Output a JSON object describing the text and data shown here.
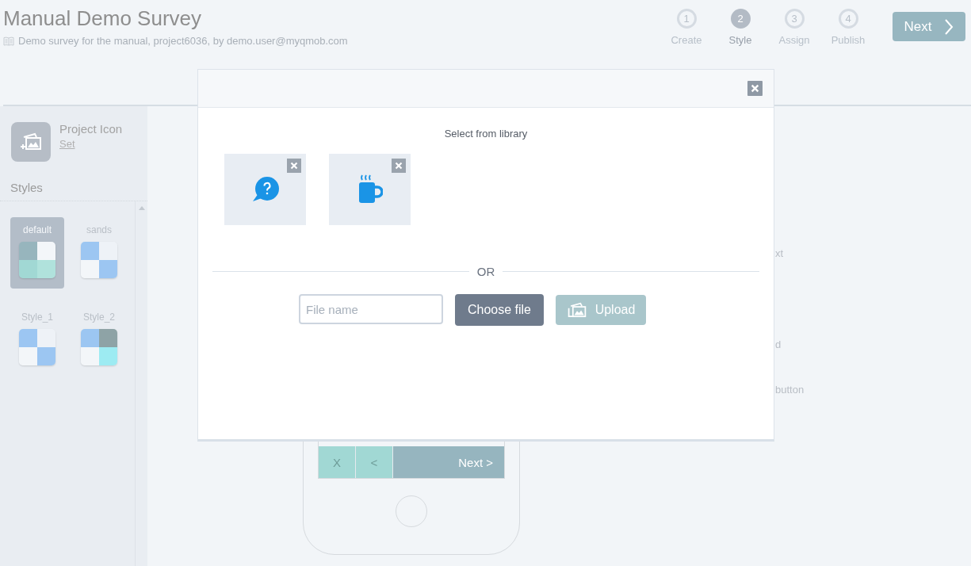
{
  "header": {
    "title": "Manual Demo Survey",
    "subtitle": "Demo survey for the manual, project6036, by demo.user@myqmob.com"
  },
  "steps": [
    {
      "number": "1",
      "label": "Create",
      "selected": false
    },
    {
      "number": "2",
      "label": "Style",
      "selected": true
    },
    {
      "number": "3",
      "label": "Assign",
      "selected": false
    },
    {
      "number": "4",
      "label": "Publish",
      "selected": false
    }
  ],
  "next_button": "Next",
  "sidebar": {
    "project_icon": {
      "label": "Project Icon",
      "link": "Set"
    },
    "styles_heading": "Styles",
    "styles": [
      {
        "name": "default",
        "selected": true,
        "swatch": [
          {
            "color": "#97b5bd"
          },
          {
            "color": "#f3f6f9"
          },
          {
            "color": "#a1d8d4"
          },
          {
            "color": "#b0e2dc"
          }
        ]
      },
      {
        "name": "sands",
        "selected": false,
        "swatch": [
          {
            "color": "#9cc6f2"
          },
          {
            "color": "#eef2f7"
          },
          {
            "color": "#f3f6f9"
          },
          {
            "color": "#9cc6f2"
          }
        ]
      },
      {
        "name": "Style_1",
        "selected": false,
        "swatch": [
          {
            "color": "#9cc6f2"
          },
          {
            "color": "#eef2f7"
          },
          {
            "color": "#f3f6f9"
          },
          {
            "color": "#9cc6f2"
          }
        ]
      },
      {
        "name": "Style_2",
        "selected": false,
        "swatch": [
          {
            "color": "#9cc6f2"
          },
          {
            "color": "#8ea3a6"
          },
          {
            "color": "#f3f6f9"
          },
          {
            "color": "#9debf2"
          }
        ]
      }
    ]
  },
  "preview": {
    "buttons": [
      {
        "label": "X",
        "kind": "secondary"
      },
      {
        "label": "<",
        "kind": "secondary"
      },
      {
        "label": "Next >",
        "kind": "primary"
      }
    ],
    "side_labels": [
      "xt",
      "d",
      "button"
    ]
  },
  "modal": {
    "library_heading": "Select from library",
    "library": [
      {
        "kind": "question"
      },
      {
        "kind": "mug"
      }
    ],
    "divider": "OR",
    "file_field": {
      "placeholder": "File name"
    },
    "choose_button": "Choose file",
    "upload_button": "Upload"
  }
}
